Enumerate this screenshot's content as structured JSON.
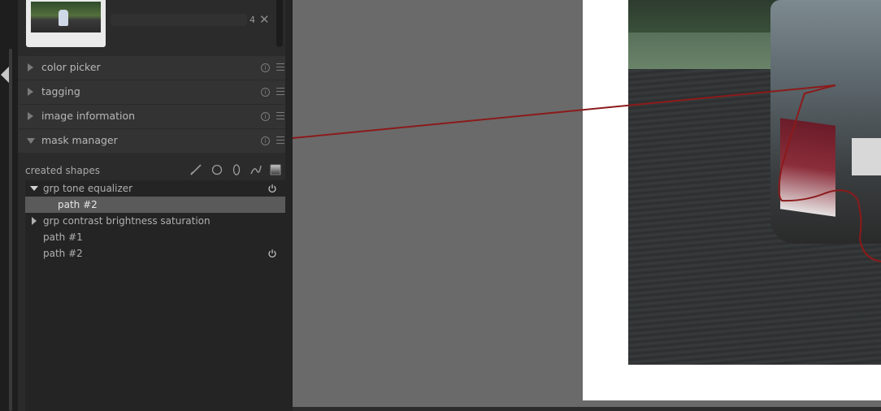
{
  "thumbnail": {
    "count": "4",
    "close_symbol": "✕"
  },
  "modules": [
    {
      "label": "color picker",
      "expanded": false
    },
    {
      "label": "tagging",
      "expanded": false
    },
    {
      "label": "image information",
      "expanded": false
    },
    {
      "label": "mask manager",
      "expanded": true
    }
  ],
  "mask_manager": {
    "heading": "created shapes",
    "tools": [
      "brush-icon",
      "circle-icon",
      "ellipse-icon",
      "path-icon",
      "gradient-icon"
    ],
    "rows": [
      {
        "label": "grp tone equalizer",
        "kind": "group",
        "expanded": true,
        "selected": false,
        "power": true
      },
      {
        "label": "path #2",
        "kind": "child",
        "selected": true,
        "power": false
      },
      {
        "label": "grp contrast brightness saturation",
        "kind": "group",
        "expanded": false,
        "selected": false,
        "power": false
      },
      {
        "label": "path #1",
        "kind": "shape",
        "selected": false,
        "power": false
      },
      {
        "label": "path #2",
        "kind": "shape",
        "selected": false,
        "power": true
      }
    ]
  },
  "colors": {
    "mask_outline": "#8c1a1a",
    "canvas_background": "#6a6a6a",
    "panel_background": "#2b2b2b"
  }
}
